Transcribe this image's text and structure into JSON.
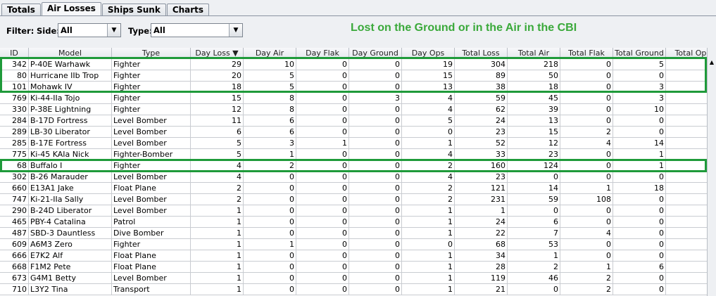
{
  "tabs": [
    "Totals",
    "Air Losses",
    "Ships Sunk",
    "Charts"
  ],
  "active_tab": 1,
  "filter": {
    "label": "Filter:",
    "side_label": "Side:",
    "side_value": "All",
    "type_label": "Type:",
    "type_value": "All"
  },
  "caption": "Lost on the Ground or in the Air in the CBI",
  "columns": [
    "ID",
    "Model",
    "Type",
    "Day Loss ▼",
    "Day Air",
    "Day Flak",
    "Day Ground",
    "Day Ops",
    "Total Loss",
    "Total Air",
    "Total Flak",
    "Total Ground",
    "Total Op"
  ],
  "rows": [
    [
      "342",
      "P-40E Warhawk",
      "Fighter",
      "29",
      "10",
      "0",
      "0",
      "19",
      "304",
      "218",
      "0",
      "5",
      ""
    ],
    [
      "80",
      "Hurricane IIb Trop",
      "Fighter",
      "20",
      "5",
      "0",
      "0",
      "15",
      "89",
      "50",
      "0",
      "0",
      ""
    ],
    [
      "101",
      "Mohawk IV",
      "Fighter",
      "18",
      "5",
      "0",
      "0",
      "13",
      "38",
      "18",
      "0",
      "3",
      ""
    ],
    [
      "769",
      "Ki-44-IIa Tojo",
      "Fighter",
      "15",
      "8",
      "0",
      "3",
      "4",
      "59",
      "45",
      "0",
      "3",
      ""
    ],
    [
      "330",
      "P-38E Lightning",
      "Fighter",
      "12",
      "8",
      "0",
      "0",
      "4",
      "62",
      "39",
      "0",
      "10",
      ""
    ],
    [
      "284",
      "B-17D Fortress",
      "Level Bomber",
      "11",
      "6",
      "0",
      "0",
      "5",
      "24",
      "13",
      "0",
      "0",
      ""
    ],
    [
      "289",
      "LB-30 Liberator",
      "Level Bomber",
      "6",
      "6",
      "0",
      "0",
      "0",
      "23",
      "15",
      "2",
      "0",
      ""
    ],
    [
      "285",
      "B-17E Fortress",
      "Level Bomber",
      "5",
      "3",
      "1",
      "0",
      "1",
      "52",
      "12",
      "4",
      "14",
      ""
    ],
    [
      "775",
      "Ki-45 KAIa Nick",
      "Fighter-Bomber",
      "5",
      "1",
      "0",
      "0",
      "4",
      "33",
      "23",
      "0",
      "1",
      ""
    ],
    [
      "68",
      "Buffalo I",
      "Fighter",
      "4",
      "2",
      "0",
      "0",
      "2",
      "160",
      "124",
      "0",
      "1",
      ""
    ],
    [
      "302",
      "B-26 Marauder",
      "Level Bomber",
      "4",
      "0",
      "0",
      "0",
      "4",
      "23",
      "0",
      "0",
      "0",
      ""
    ],
    [
      "660",
      "E13A1 Jake",
      "Float Plane",
      "2",
      "0",
      "0",
      "0",
      "2",
      "121",
      "14",
      "1",
      "18",
      ""
    ],
    [
      "747",
      "Ki-21-IIa Sally",
      "Level Bomber",
      "2",
      "0",
      "0",
      "0",
      "2",
      "231",
      "59",
      "108",
      "0",
      ""
    ],
    [
      "290",
      "B-24D Liberator",
      "Level Bomber",
      "1",
      "0",
      "0",
      "0",
      "1",
      "1",
      "0",
      "0",
      "0",
      ""
    ],
    [
      "465",
      "PBY-4 Catalina",
      "Patrol",
      "1",
      "0",
      "0",
      "0",
      "1",
      "24",
      "6",
      "0",
      "0",
      ""
    ],
    [
      "487",
      "SBD-3 Dauntless",
      "Dive Bomber",
      "1",
      "0",
      "0",
      "0",
      "1",
      "22",
      "7",
      "4",
      "0",
      ""
    ],
    [
      "609",
      "A6M3 Zero",
      "Fighter",
      "1",
      "1",
      "0",
      "0",
      "0",
      "68",
      "53",
      "0",
      "0",
      ""
    ],
    [
      "666",
      "E7K2 Alf",
      "Float Plane",
      "1",
      "0",
      "0",
      "0",
      "1",
      "34",
      "1",
      "0",
      "0",
      ""
    ],
    [
      "668",
      "F1M2 Pete",
      "Float Plane",
      "1",
      "0",
      "0",
      "0",
      "1",
      "28",
      "2",
      "1",
      "6",
      ""
    ],
    [
      "673",
      "G4M1 Betty",
      "Level Bomber",
      "1",
      "0",
      "0",
      "0",
      "1",
      "119",
      "46",
      "2",
      "0",
      ""
    ],
    [
      "710",
      "L3Y2 Tina",
      "Transport",
      "1",
      "0",
      "0",
      "0",
      "1",
      "21",
      "0",
      "2",
      "0",
      ""
    ]
  ],
  "colors": {
    "highlight": "#1f9a3a",
    "caption": "#3aa93a"
  }
}
